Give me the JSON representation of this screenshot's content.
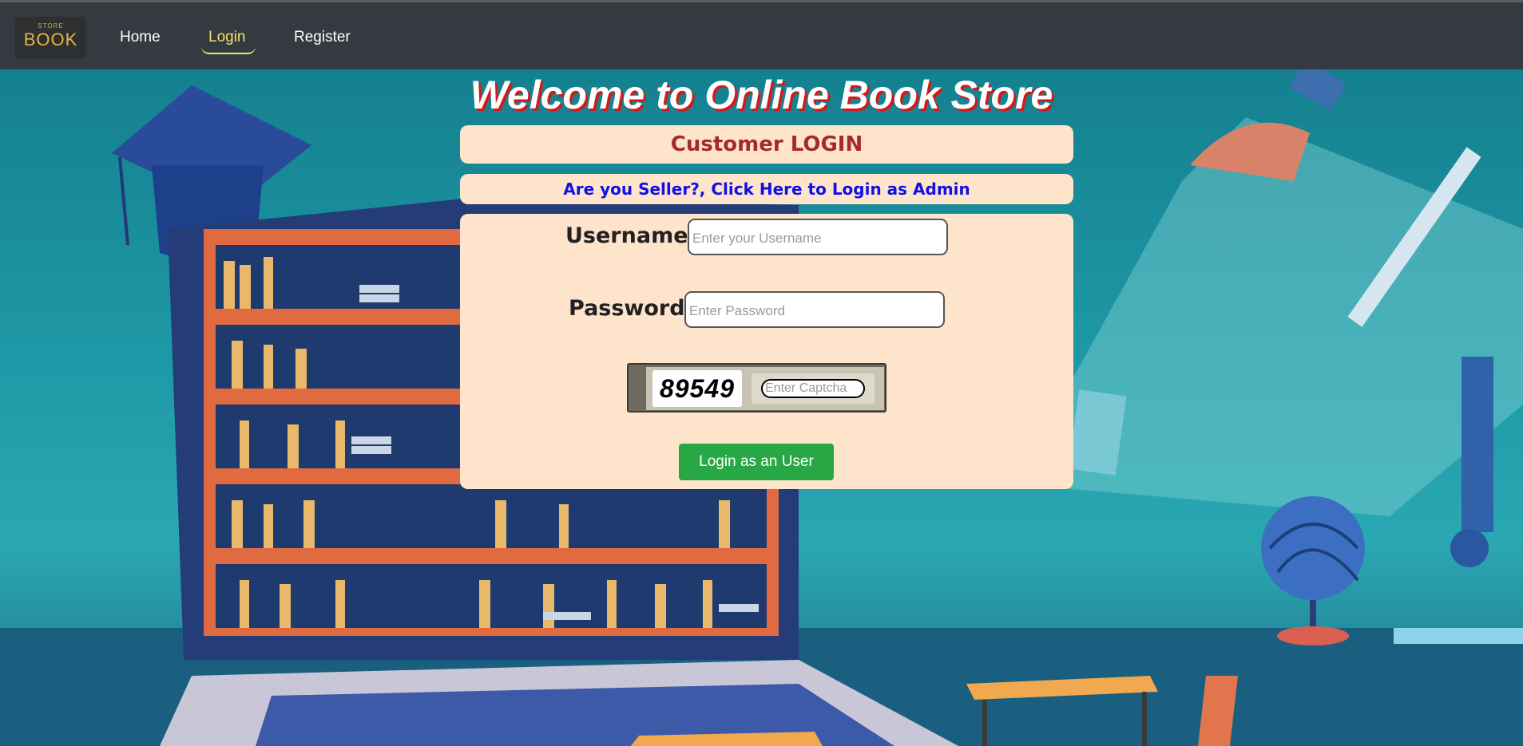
{
  "nav": {
    "brand_top": "STORE",
    "brand_word": "BOOK",
    "home": "Home",
    "login": "Login",
    "register": "Register"
  },
  "main": {
    "welcome": "Welcome to Online Book Store",
    "title": "Customer LOGIN",
    "admin_link": "Are you Seller?, Click Here to Login as Admin",
    "username_label": "Username :",
    "username_placeholder": "Enter your Username",
    "password_label": "Password :",
    "password_placeholder": "Enter Password",
    "captcha_code": "89549",
    "captcha_placeholder": "Enter Captcha",
    "login_button": "Login as an User"
  },
  "colors": {
    "navbar": "#343a40",
    "active_link": "#f1e36a",
    "panel": "#ffe4cc",
    "title": "#a52a2a",
    "admin_link": "#1010e6",
    "button": "#28a745"
  }
}
